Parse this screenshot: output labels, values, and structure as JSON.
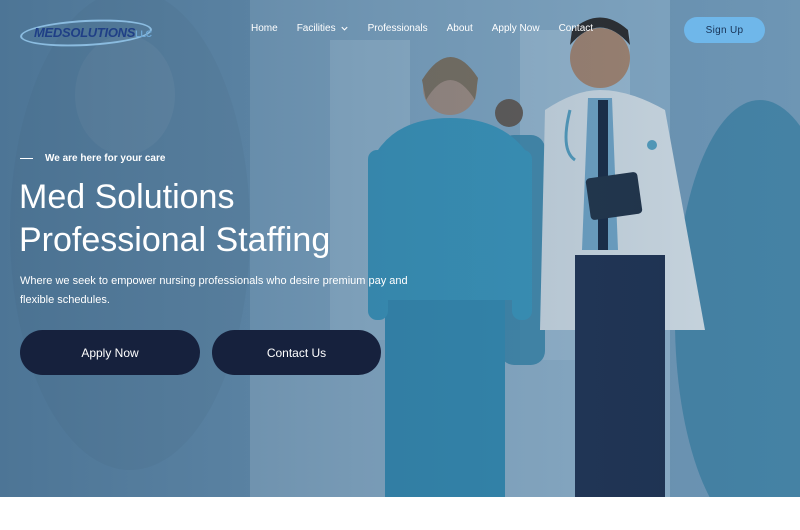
{
  "brand": {
    "logo_text": "MEDSOLUTIONS",
    "logo_suffix": "LLC"
  },
  "nav": {
    "items": [
      {
        "label": "Home"
      },
      {
        "label": "Facilities",
        "has_dropdown": true
      },
      {
        "label": "Professionals"
      },
      {
        "label": "About"
      },
      {
        "label": "Apply Now"
      },
      {
        "label": "Contact"
      }
    ],
    "signup_label": "Sign Up"
  },
  "hero": {
    "tagline": "We are here for your care",
    "headline_line1": "Med Solutions",
    "headline_line2": "Professional Staffing",
    "subtext": "Where we seek to empower nursing professionals who desire premium pay and flexible schedules.",
    "primary_button": "Apply Now",
    "secondary_button": "Contact Us",
    "image_icon": "hospital-corridor-photo"
  },
  "colors": {
    "accent": "#6fb7ea",
    "button_dark": "#16213d",
    "logo_blue": "#1f3f86",
    "overlay": "#2f5a7d"
  }
}
